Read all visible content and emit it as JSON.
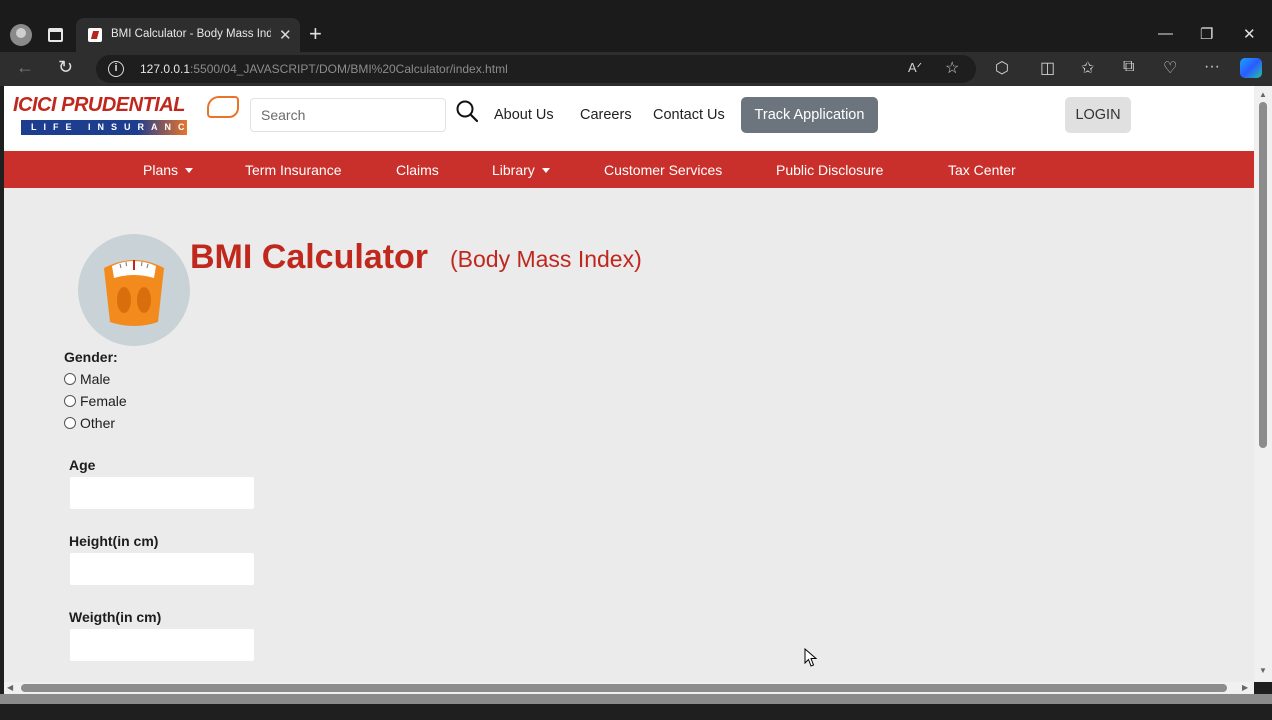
{
  "browser": {
    "tab_title": "BMI Calculator - Body Mass Inde",
    "tab_close": "✕",
    "new_tab": "+",
    "url_host": "127.0.0.1",
    "url_rest": ":5500/04_JAVASCRIPT/DOM/BMI%20Calculator/index.html",
    "icons": [
      "profile-icon",
      "tabs-icon",
      "back-icon",
      "reload-icon",
      "info-icon",
      "read-aloud-icon",
      "favorite-icon",
      "extensions-icon",
      "split-screen-icon",
      "favorites-icon",
      "collections-icon",
      "performance-icon",
      "more-icon",
      "copilot-icon",
      "minimize-icon",
      "restore-icon",
      "close-icon"
    ]
  },
  "header": {
    "logo_text": "ICICI PRUDENTIAL",
    "logo_sub": "LIFE INSURANCE",
    "search_placeholder": "Search",
    "links": [
      "About Us",
      "Careers",
      "Contact Us"
    ],
    "track_button": "Track Application",
    "login_button": "LOGIN"
  },
  "red_nav": {
    "items": [
      "Plans",
      "Term Insurance",
      "Claims",
      "Library",
      "Customer Services",
      "Public Disclosure",
      "Tax Center"
    ]
  },
  "main": {
    "title": "BMI Calculator",
    "subtitle": "(Body Mass Index)",
    "gender_label": "Gender:",
    "gender_options": [
      "Male",
      "Female",
      "Other"
    ],
    "age_label": "Age",
    "height_label": "Height(in cm)",
    "weight_label": "Weigth(in cm)",
    "age_value": "",
    "height_value": "",
    "weight_value": ""
  },
  "colors": {
    "brand_red": "#c9302c",
    "title_red": "#c0281e",
    "track_button_bg": "#6c757d",
    "page_bg": "#ebebeb",
    "scale_orange": "#f28a1e"
  }
}
